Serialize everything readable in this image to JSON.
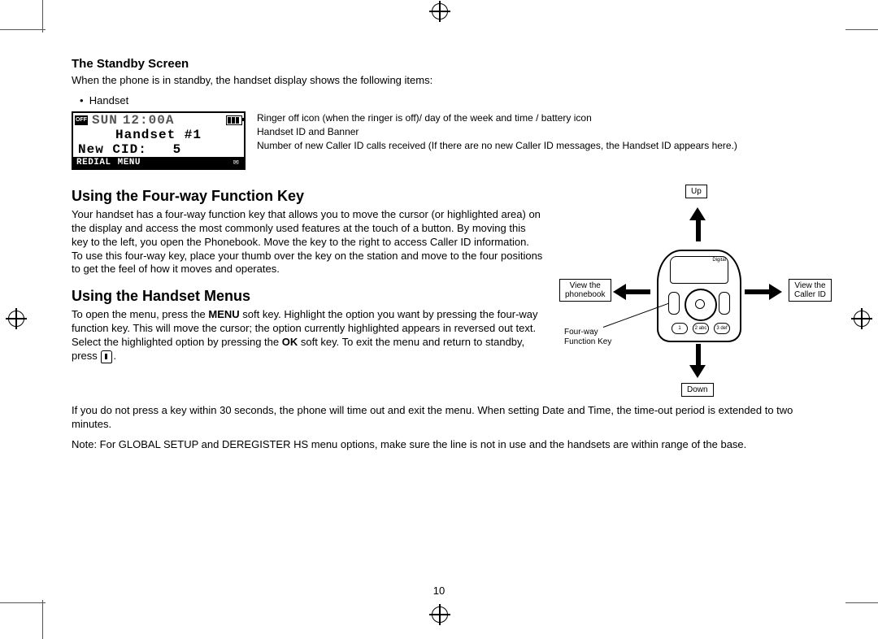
{
  "page_number": "10",
  "sections": {
    "standby": {
      "heading": "The Standby Screen",
      "intro": "When the phone is in standby, the handset display shows the following items:",
      "bullet": "Handset",
      "lcd": {
        "off_label": "OFF",
        "row1_day": "SUN",
        "row1_time": "12:00A",
        "row2": "Handset #1",
        "row3": "New CID:   5",
        "soft_left": "REDIAL",
        "soft_mid": "MENU",
        "envelope": "✉"
      },
      "callouts": {
        "c1": "Ringer off icon (when the ringer is off)/ day of the week and time / battery icon",
        "c2": "Handset ID and Banner",
        "c3": "Number of new Caller ID calls received (If there are no new Caller ID messages, the Handset ID appears here.)"
      }
    },
    "fourway": {
      "heading": "Using the Four-way Function Key",
      "body": "Your handset has a four-way function key that allows you to move the cursor (or highlighted area) on the display and access the most commonly used features at the touch of a button. By moving this key to the left, you open the Phonebook. Move the key to the right to access Caller ID information. To use this four-way key, place your thumb over the key on the station and move to the four positions to get the feel of how it moves and operates."
    },
    "menus": {
      "heading": "Using the Handset Menus",
      "p1a": "To open the menu, press the ",
      "p1b": "MENU",
      "p1c": " soft key. Highlight the option you want by pressing the four-way function key. This will move the cursor; the option currently highlighted appears in reversed out text. Select the highlighted option by pressing the ",
      "p1d": "OK",
      "p1e": " soft key. To exit the menu and return to standby, press ",
      "p1f": ".",
      "p2": "If you do not press a key within 30 seconds, the phone will time out and exit the menu. When setting Date and Time, the time-out period is extended to two minutes.",
      "p3": "Note: For GLOBAL SETUP and DEREGISTER HS menu options, make sure the line is not in use and the handsets are within range of the base."
    },
    "diagram": {
      "up": "Up",
      "down": "Down",
      "left_line1": "View the",
      "left_line2": "phonebook",
      "right_line1": "View the",
      "right_line2": "Caller ID",
      "key_label_line1": "Four-way",
      "key_label_line2": "Function Key",
      "screen_brand": "Digital",
      "keys": {
        "k1": "1",
        "k2": "2 abc",
        "k3": "3 def"
      }
    }
  }
}
